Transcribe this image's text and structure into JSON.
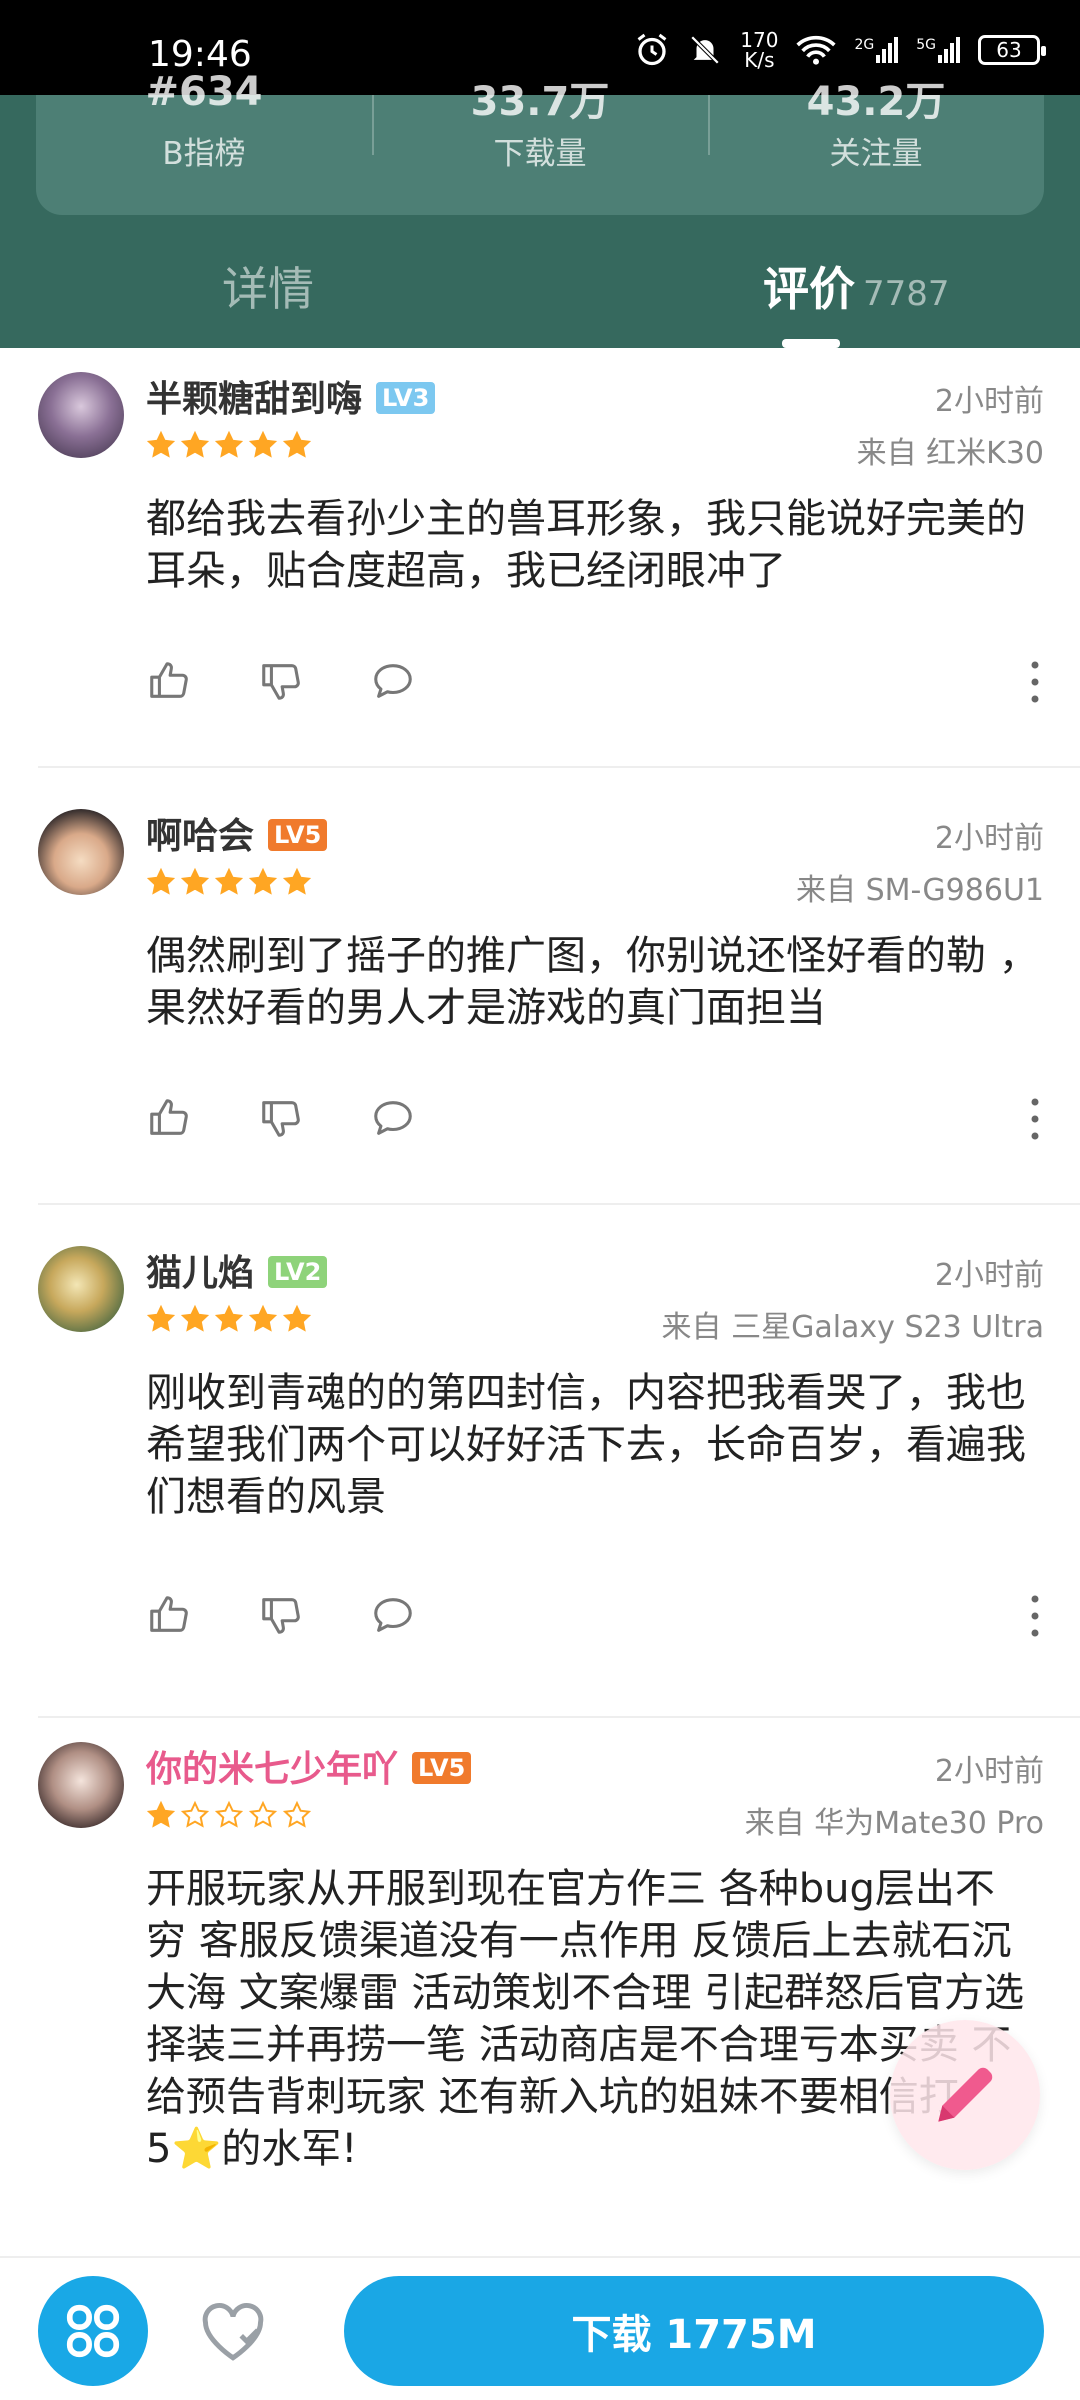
{
  "status_bar": {
    "time": "19:46",
    "speed": "170",
    "speed_unit": "K/s",
    "net1": "2G",
    "net2": "5G",
    "battery": "63"
  },
  "stats": [
    {
      "value": "#634",
      "label": "B指榜"
    },
    {
      "value": "33.7万",
      "label": "下载量"
    },
    {
      "value": "43.2万",
      "label": "关注量"
    }
  ],
  "tabs": {
    "detail": "详情",
    "review": "评价",
    "review_count": "7787"
  },
  "reviews": [
    {
      "name": "半颗糖甜到嗨",
      "level": "LV3",
      "level_color": "#7cc8f0",
      "name_color": "#333333",
      "time": "2小时前",
      "device": "来自 红米K30",
      "rating": 5,
      "content": "都给我去看孙少主的兽耳形象，我只能说好完美的耳朵，贴合度超高，我已经闭眼冲了"
    },
    {
      "name": "啊哈会",
      "level": "LV5",
      "level_color": "#f07a2c",
      "name_color": "#333333",
      "time": "2小时前",
      "device": "来自 SM-G986U1",
      "rating": 5,
      "content": "偶然刷到了摇子的推广图，你别说还怪好看的勒 ，果然好看的男人才是游戏的真门面担当"
    },
    {
      "name": "猫儿焰",
      "level": "LV2",
      "level_color": "#8ed37a",
      "name_color": "#333333",
      "time": "2小时前",
      "device": "来自 三星Galaxy S23 Ultra",
      "rating": 5,
      "content": "刚收到青魂的的第四封信，内容把我看哭了，我也希望我们两个可以好好活下去，长命百岁，看遍我们想看的风景"
    },
    {
      "name": "你的米七少年吖",
      "level": "LV5",
      "level_color": "#f07a2c",
      "name_color": "#e85a8c",
      "time": "2小时前",
      "device": "来自 华为Mate30 Pro",
      "rating": 1,
      "content": "开服玩家从开服到现在官方作三 各种bug层出不穷 客服反馈渠道没有一点作用 反馈后上去就石沉大海 文案爆雷 活动策划不合理 引起群怒后官方选择装三并再捞一笔 活动商店是不合理亏本买卖 不给预告背刺玩家 还有新入坑的姐妹不要相信打5⭐的水军!"
    }
  ],
  "bottom": {
    "download_label": "下载 1775M"
  },
  "colors": {
    "header_bg": "#36695e",
    "accent": "#1aa7e5",
    "star": "#ffa623"
  }
}
